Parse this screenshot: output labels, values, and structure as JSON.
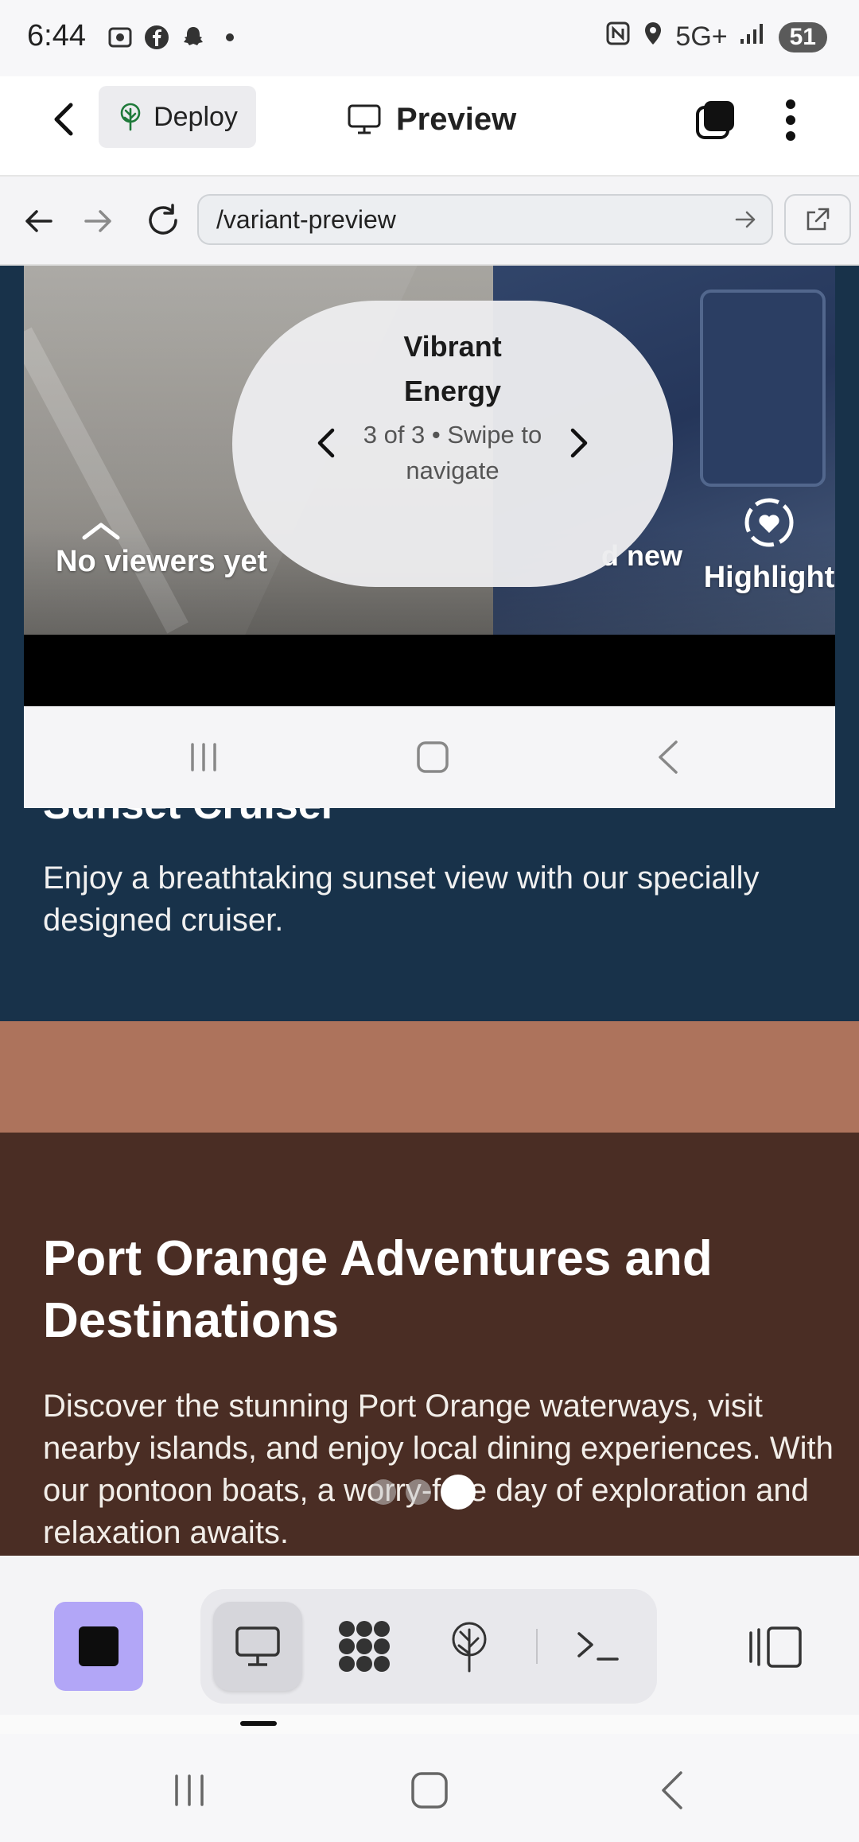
{
  "status_bar": {
    "time": "6:44",
    "network": "5G+",
    "battery": "51",
    "icons": [
      "screenshot-icon",
      "facebook-icon",
      "snapchat-icon",
      "dot-icon",
      "nfc-icon",
      "location-icon",
      "signal-icon"
    ]
  },
  "app_toolbar": {
    "deploy_label": "Deploy",
    "preview_label": "Preview"
  },
  "browser": {
    "url": "/variant-preview"
  },
  "carousel": {
    "title": "Vibrant Energy",
    "subtitle": "3 of 3 • Swipe to navigate",
    "viewers_label": "No viewers yet",
    "add_new_label": "d new",
    "highlight_label": "Highlight",
    "current": 3,
    "total": 3
  },
  "sections": {
    "cruiser_heading": "Sunset Cruiser",
    "cruiser_desc": "Enjoy a breathtaking sunset view with our specially designed cruiser.",
    "port_heading": "Port Orange Adventures and Destinations",
    "port_desc": "Discover the stunning Port Orange waterways, visit nearby islands, and enjoy local dining experiences. With our pontoon boats, a worry-free day of exploration and relaxation awaits."
  },
  "colors": {
    "cruiser_bg": "#18324a",
    "orange_band": "#ad735c",
    "brown_bg": "#4a2d24",
    "stop_button": "#b2a6f7"
  },
  "bottom_toolbar": {
    "tabs": [
      "monitor-icon",
      "apps-icon",
      "deploy-icon",
      "terminal-icon"
    ],
    "active_tab": "monitor-icon"
  }
}
